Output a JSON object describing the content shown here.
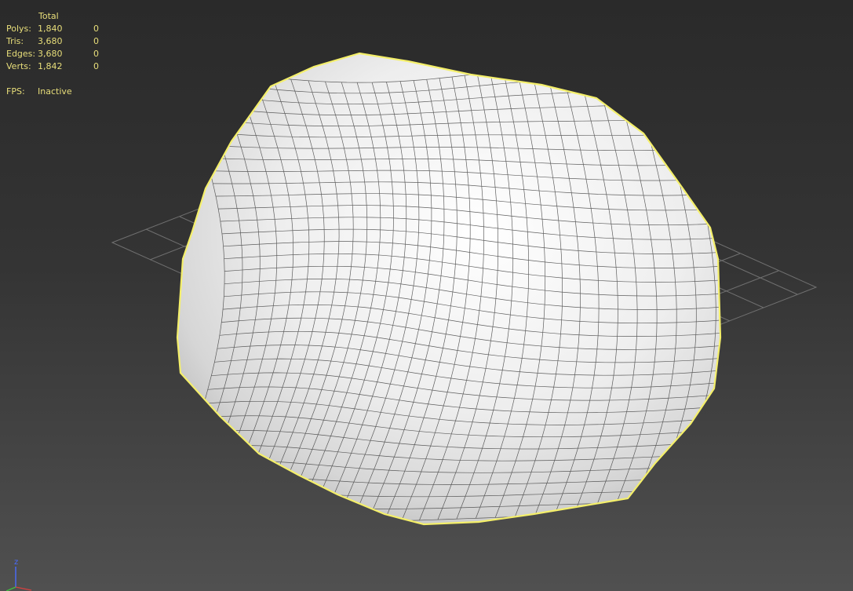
{
  "stats": {
    "header": "Total",
    "rows": [
      {
        "label": "Polys:",
        "value": "1,840",
        "selected": "0"
      },
      {
        "label": "Tris:",
        "value": "3,680",
        "selected": "0"
      },
      {
        "label": "Edges:",
        "value": "3,680",
        "selected": "0"
      },
      {
        "label": "Verts:",
        "value": "1,842",
        "selected": "0"
      }
    ],
    "fps_label": "FPS:",
    "fps_value": "Inactive"
  },
  "axis": {
    "z_label": "z"
  },
  "colors": {
    "stats_text": "#e8de7a",
    "selection_outline": "#f4ef6a",
    "mesh_surface": "#f0f0f0",
    "wire": "#3a3a3a",
    "grid": "#707070",
    "axis_z": "#4a6cff",
    "axis_x": "#d84040",
    "axis_y": "#40c040"
  }
}
